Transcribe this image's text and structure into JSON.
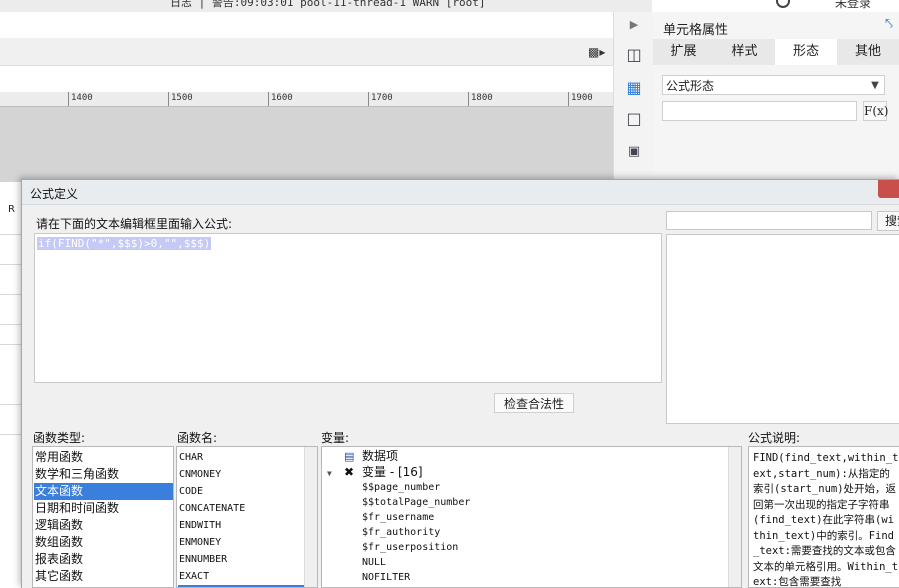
{
  "top": {
    "status_text": "日志 | 警告:09:03:01 pool-11-thread-1 WARN [root]",
    "user": "未登录",
    "search_icon": "search-icon"
  },
  "toolbar": {
    "format_icon": "format-painter-icon"
  },
  "ruler": {
    "ticks": [
      "1400",
      "1500",
      "1600",
      "1700",
      "1800",
      "1900"
    ]
  },
  "sidebar_icons": [
    "collapse-arrow-icon",
    "table-layout-icon",
    "cell-attributes-icon",
    "border-icon",
    "dropdown-widget-icon"
  ],
  "right_panel": {
    "title": "单元格属性",
    "tabs": [
      "扩展",
      "样式",
      "形态",
      "其他"
    ],
    "active_tab": "形态",
    "form_select_value": "公式形态",
    "fx_label": "F(x)"
  },
  "grid": {
    "column_letter": "R"
  },
  "dialog": {
    "title": "公式定义",
    "prompt": "请在下面的文本编辑框里面输入公式:",
    "formula": "if(FIND(\"*\",$$$)>0,\"\",$$$)",
    "check_button": "检查合法性",
    "search_button": "搜索",
    "categories_label": "函数类型:",
    "categories": [
      "常用函数",
      "数学和三角函数",
      "文本函数",
      "日期和时间函数",
      "逻辑函数",
      "数组函数",
      "报表函数",
      "其它函数"
    ],
    "selected_category": "文本函数",
    "functions_label": "函数名:",
    "functions": [
      "CHAR",
      "CNMONEY",
      "CODE",
      "CONCATENATE",
      "ENDWITH",
      "ENMONEY",
      "ENNUMBER",
      "EXACT"
    ],
    "variables_label": "变量:",
    "variables": {
      "data_item": "数据项",
      "variables_node": "变量 - [16]",
      "items": [
        "$$page_number",
        "$$totalPage_number",
        "$fr_username",
        "$fr_authority",
        "$fr_userposition",
        "NULL",
        "NOFILTER"
      ]
    },
    "description_label": "公式说明:",
    "description": "FIND(find_text,within_text,start_num):从指定的索引(start_num)处开始，返回第一次出现的指定子字符串(find_text)在此字符串(within_text)中的索引。Find_text:需要查找的文本或包含文本的单元格引用。Within_text:包含需要查找"
  }
}
